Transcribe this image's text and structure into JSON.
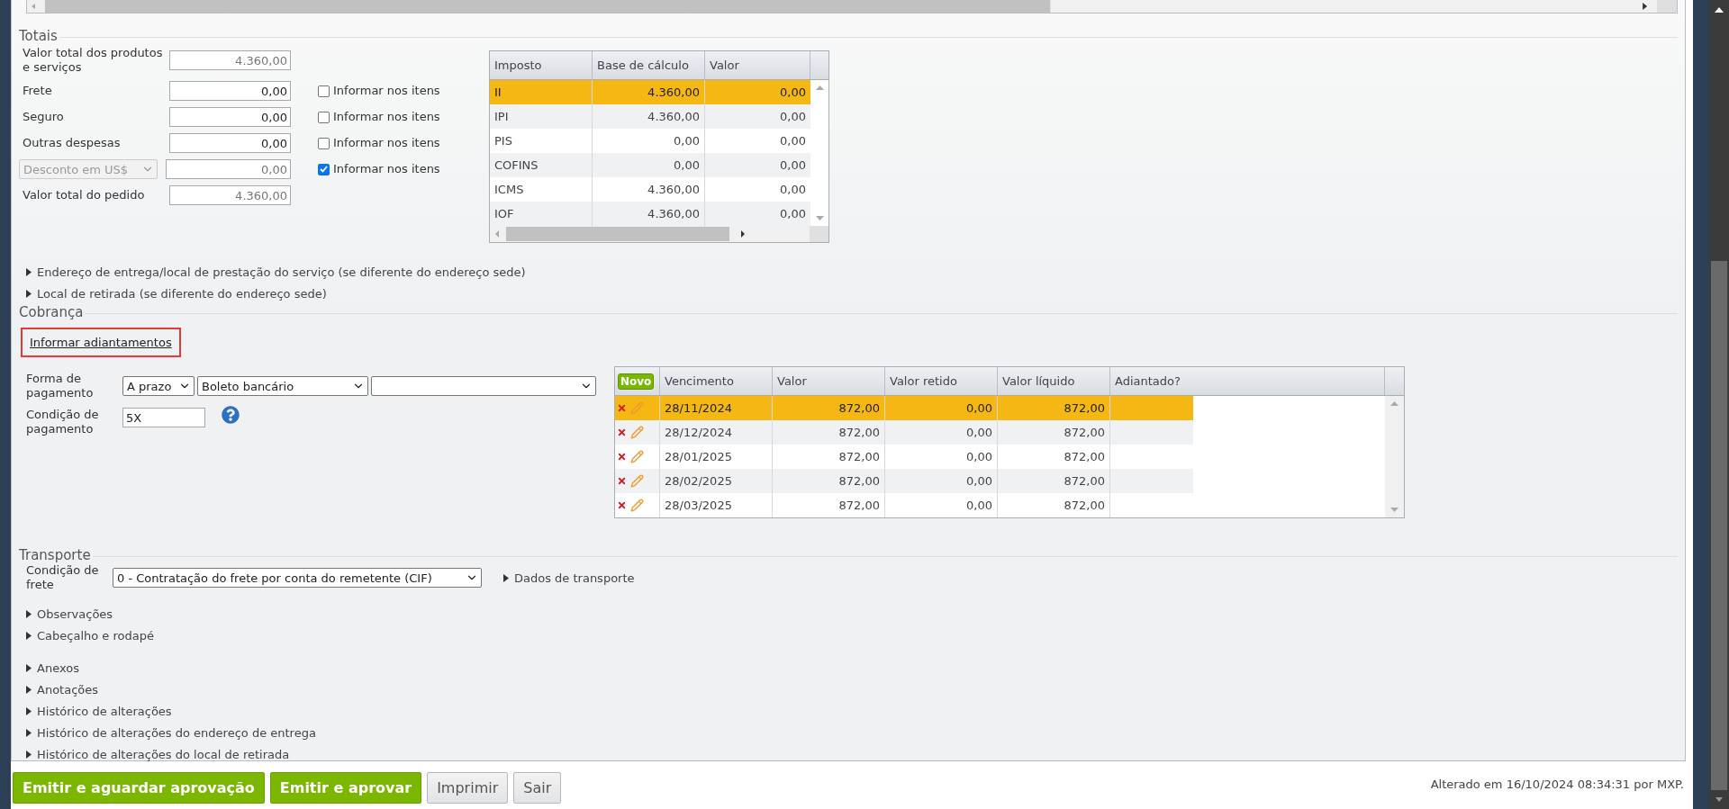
{
  "totais": {
    "title": "Totais",
    "fields": [
      {
        "kind": "label",
        "label": "Valor total dos produtos e serviços",
        "value": "4.360,00",
        "readonly": true
      },
      {
        "kind": "label",
        "label": "Frete",
        "value": "0,00",
        "readonly": false,
        "option": {
          "label": "Informar nos itens",
          "checked": false
        }
      },
      {
        "kind": "label",
        "label": "Seguro",
        "value": "0,00",
        "readonly": false,
        "option": {
          "label": "Informar nos itens",
          "checked": false
        }
      },
      {
        "kind": "label",
        "label": "Outras despesas",
        "value": "0,00",
        "readonly": false,
        "option": {
          "label": "Informar nos itens",
          "checked": false
        }
      },
      {
        "kind": "select",
        "label": "Desconto em US$",
        "value": "0,00",
        "readonly": true,
        "option": {
          "label": "Informar nos itens",
          "checked": true
        }
      },
      {
        "kind": "label",
        "label": "Valor total do pedido",
        "value": "4.360,00",
        "readonly": true
      }
    ],
    "tax_table": {
      "columns": [
        "Imposto",
        "Base de cálculo",
        "Valor"
      ],
      "rows": [
        {
          "cells": [
            "II",
            "4.360,00",
            "0,00"
          ],
          "selected": true
        },
        {
          "cells": [
            "IPI",
            "4.360,00",
            "0,00"
          ],
          "selected": false
        },
        {
          "cells": [
            "PIS",
            "0,00",
            "0,00"
          ],
          "selected": false
        },
        {
          "cells": [
            "COFINS",
            "0,00",
            "0,00"
          ],
          "selected": false
        },
        {
          "cells": [
            "ICMS",
            "4.360,00",
            "0,00"
          ],
          "selected": false
        },
        {
          "cells": [
            "IOF",
            "4.360,00",
            "0,00"
          ],
          "selected": false
        }
      ]
    }
  },
  "address_sections": [
    {
      "label": "Endereço de entrega/local de prestação do serviço (se diferente do endereço sede)",
      "expanded": false
    },
    {
      "label": "Local de retirada (se diferente do endereço sede)",
      "expanded": false
    }
  ],
  "cobranca": {
    "title": "Cobrança",
    "advance_link": {
      "label": "Informar adiantamentos",
      "highlighted": true
    },
    "payment_method": {
      "label": "Forma de pagamento",
      "selects": [
        {
          "kind": "select",
          "value": "A prazo"
        },
        {
          "kind": "select",
          "value": "Boleto bancário"
        },
        {
          "kind": "select"
        }
      ]
    },
    "payment_condition": {
      "label": "Condição de pagamento",
      "value": "5X"
    },
    "installments": {
      "new_button": "Novo",
      "columns": [
        "Vencimento",
        "Valor",
        "Valor retido",
        "Valor líquido",
        "Adiantado?"
      ],
      "rows": [
        {
          "cells": [
            "28/11/2024",
            "872,00",
            "0,00",
            "872,00"
          ],
          "selected": true
        },
        {
          "cells": [
            "28/12/2024",
            "872,00",
            "0,00",
            "872,00"
          ],
          "selected": false
        },
        {
          "cells": [
            "28/01/2025",
            "872,00",
            "0,00",
            "872,00"
          ],
          "selected": false
        },
        {
          "cells": [
            "28/02/2025",
            "872,00",
            "0,00",
            "872,00"
          ],
          "selected": false
        },
        {
          "cells": [
            "28/03/2025",
            "872,00",
            "0,00",
            "872,00"
          ],
          "selected": false
        }
      ]
    }
  },
  "transporte": {
    "title": "Transporte",
    "freight_label": "Condição de frete",
    "freight_value": "0 - Contratação do frete por conta do remetente (CIF)",
    "details": {
      "label": "Dados de transporte",
      "expanded": false
    }
  },
  "sections": [
    [
      {
        "label": "Observações",
        "expanded": false
      },
      {
        "label": "Cabeçalho e rodapé",
        "expanded": false
      }
    ],
    [
      {
        "label": "Anexos",
        "expanded": false
      },
      {
        "label": "Anotações",
        "expanded": false
      },
      {
        "label": "Histórico de alterações",
        "expanded": false
      },
      {
        "label": "Histórico de alterações do endereço de entrega",
        "expanded": false
      },
      {
        "label": "Histórico de alterações do local de retirada",
        "expanded": false
      }
    ]
  ],
  "buttons": [
    {
      "label": "Emitir e aguardar aprovação",
      "kind": "primary"
    },
    {
      "label": "Emitir e aprovar",
      "kind": "primary"
    },
    {
      "label": "Imprimir",
      "kind": "secondary"
    },
    {
      "label": "Sair",
      "kind": "secondary"
    }
  ],
  "footer": "Alterado em 16/10/2024 08:34:31 por MXP."
}
